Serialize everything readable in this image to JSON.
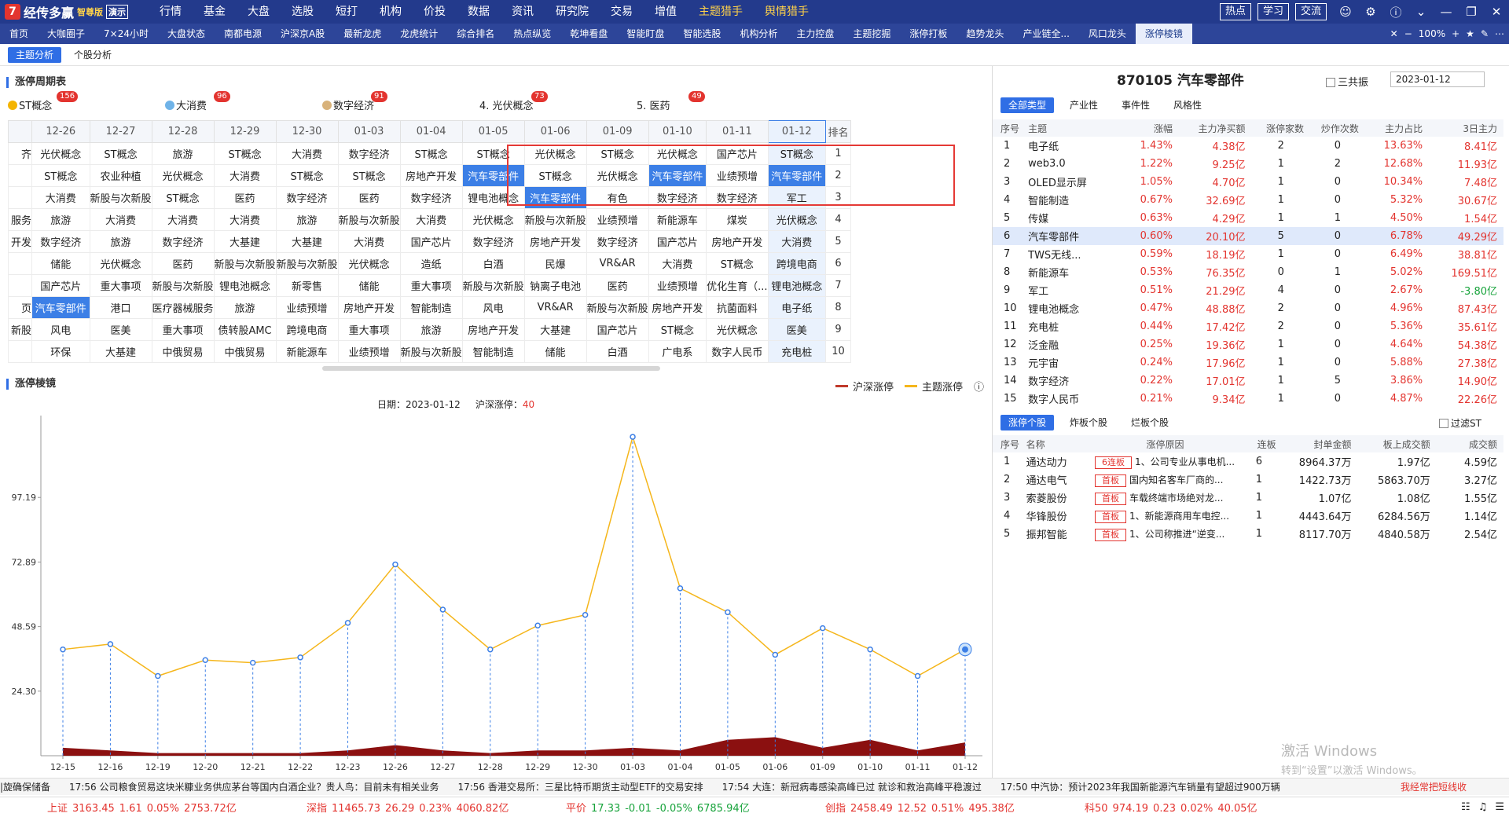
{
  "app": {
    "logo_mark": "7",
    "brand": "经传多赢",
    "edition": "智尊版",
    "demo": "演示"
  },
  "mainmenu": [
    "行情",
    "基金",
    "大盘",
    "选股",
    "短打",
    "机构",
    "价投",
    "数据",
    "资讯",
    "研究院",
    "交易",
    "增值",
    "主题猎手",
    "舆情猎手"
  ],
  "topright": {
    "hot": "热点",
    "study": "学习",
    "talk": "交流"
  },
  "tabs": [
    "首页",
    "大咖圈子",
    "7×24小时",
    "大盘状态",
    "南都电源",
    "沪深京A股",
    "最新龙虎",
    "龙虎统计",
    "综合排名",
    "热点纵览",
    "乾坤看盘",
    "智能盯盘",
    "智能选股",
    "机构分析",
    "主力控盘",
    "主题挖掘",
    "涨停打板",
    "趋势龙头",
    "产业链全...",
    "风口龙头",
    "涨停棱镜"
  ],
  "tabright": {
    "zoom": "100%"
  },
  "subtabs": [
    "主题分析",
    "个股分析"
  ],
  "cycle": {
    "title": "涨停周期表",
    "cats": [
      {
        "label": "ST概念",
        "badge": "156",
        "color": "#f4b400"
      },
      {
        "label": "大消费",
        "badge": "96",
        "color": "#6fb3e8"
      },
      {
        "label": "数字经济",
        "badge": "91",
        "color": "#d8b27a"
      },
      {
        "label": "4. 光伏概念",
        "badge": "73",
        "color": ""
      },
      {
        "label": "5. 医药",
        "badge": "49",
        "color": ""
      }
    ],
    "dates": [
      "12-26",
      "12-27",
      "12-28",
      "12-29",
      "12-30",
      "01-03",
      "01-04",
      "01-05",
      "01-06",
      "01-09",
      "01-10",
      "01-11",
      "01-12"
    ],
    "rank_header": "排名",
    "leftcol": [
      "齐",
      "",
      "",
      "服务",
      "开发",
      "",
      "",
      "页",
      "新股",
      "",
      ""
    ],
    "rows": [
      [
        "光伏概念",
        "ST概念",
        "旅游",
        "ST概念",
        "大消费",
        "数字经济",
        "ST概念",
        "ST概念",
        "光伏概念",
        "ST概念",
        "光伏概念",
        "国产芯片",
        "ST概念"
      ],
      [
        "ST概念",
        "农业种植",
        "光伏概念",
        "大消费",
        "ST概念",
        "ST概念",
        "房地产开发",
        "汽车零部件",
        "ST概念",
        "光伏概念",
        "汽车零部件",
        "业绩预增",
        "汽车零部件"
      ],
      [
        "大消费",
        "新股与次新股",
        "ST概念",
        "医药",
        "数字经济",
        "医药",
        "数字经济",
        "锂电池概念",
        "汽车零部件",
        "有色",
        "数字经济",
        "数字经济",
        "军工"
      ],
      [
        "旅游",
        "大消费",
        "大消费",
        "大消费",
        "旅游",
        "新股与次新股",
        "大消费",
        "光伏概念",
        "新股与次新股",
        "业绩预增",
        "新能源车",
        "煤炭",
        "光伏概念"
      ],
      [
        "数字经济",
        "旅游",
        "数字经济",
        "大基建",
        "大基建",
        "大消费",
        "国产芯片",
        "数字经济",
        "房地产开发",
        "数字经济",
        "国产芯片",
        "房地产开发",
        "大消费"
      ],
      [
        "储能",
        "光伏概念",
        "医药",
        "新股与次新股",
        "新股与次新股",
        "光伏概念",
        "造纸",
        "白酒",
        "民爆",
        "VR&AR",
        "大消费",
        "ST概念",
        "跨境电商"
      ],
      [
        "国产芯片",
        "重大事项",
        "新股与次新股",
        "锂电池概念",
        "新零售",
        "储能",
        "重大事项",
        "新股与次新股",
        "钠离子电池",
        "医药",
        "业绩预增",
        "优化生育（...",
        "锂电池概念"
      ],
      [
        "汽车零部件",
        "港口",
        "医疗器械服务",
        "旅游",
        "业绩预增",
        "房地产开发",
        "智能制造",
        "风电",
        "VR&AR",
        "新股与次新股",
        "房地产开发",
        "抗菌面料",
        "电子纸"
      ],
      [
        "风电",
        "医美",
        "重大事项",
        "债转股AMC",
        "跨境电商",
        "重大事项",
        "旅游",
        "房地产开发",
        "大基建",
        "国产芯片",
        "ST概念",
        "光伏概念",
        "医美"
      ],
      [
        "环保",
        "大基建",
        "中俄贸易",
        "中俄贸易",
        "新能源车",
        "业绩预增",
        "新股与次新股",
        "智能制造",
        "储能",
        "白酒",
        "广电系",
        "数字人民币",
        "充电桩"
      ]
    ],
    "ranks": [
      "1",
      "2",
      "3",
      "4",
      "5",
      "6",
      "7",
      "8",
      "9",
      "10"
    ]
  },
  "prism": {
    "title": "涨停棱镜",
    "legend": {
      "a": "沪深涨停",
      "b": "主题涨停",
      "a_color": "#c0392b",
      "b_color": "#f5b61b"
    },
    "date_label": "日期：",
    "date": "2023-01-12",
    "count_label": "沪深涨停：",
    "count": "40"
  },
  "chart_data": {
    "type": "line",
    "x": [
      "12-15",
      "12-16",
      "12-19",
      "12-20",
      "12-21",
      "12-22",
      "12-23",
      "12-26",
      "12-27",
      "12-28",
      "12-29",
      "12-30",
      "01-03",
      "01-04",
      "01-05",
      "01-06",
      "01-09",
      "01-10",
      "01-11",
      "01-12"
    ],
    "series": [
      {
        "name": "沪深涨停",
        "type": "line",
        "values": [
          40,
          42,
          30,
          36,
          35,
          37,
          50,
          72,
          55,
          40,
          49,
          53,
          120,
          63,
          54,
          38,
          48,
          40,
          30,
          40
        ],
        "color": "#f5b61b"
      },
      {
        "name": "主题涨停",
        "type": "area",
        "values": [
          3,
          2,
          1,
          1,
          1,
          1,
          2,
          4,
          2,
          1,
          2,
          2,
          3,
          2,
          6,
          7,
          3,
          6,
          2,
          5
        ],
        "color": "#8b1010"
      }
    ],
    "y_ticks": [
      "24.30",
      "48.59",
      "72.89",
      "97.19"
    ],
    "ylim": [
      0,
      128
    ]
  },
  "stock": {
    "title": "870105 汽车零部件",
    "sanban": "三共振",
    "date": "2023-01-12",
    "tabs": [
      "全部类型",
      "产业性",
      "事件性",
      "风格性"
    ],
    "headers": [
      "序号",
      "主题",
      "涨幅",
      "主力净买额",
      "涨停家数",
      "炒作次数",
      "主力占比",
      "3日主力"
    ],
    "rows": [
      [
        "1",
        "电子纸",
        "1.43%",
        "4.38亿",
        "2",
        "0",
        "13.63%",
        "8.41亿"
      ],
      [
        "2",
        "web3.0",
        "1.22%",
        "9.25亿",
        "1",
        "2",
        "12.68%",
        "11.93亿"
      ],
      [
        "3",
        "OLED显示屏",
        "1.05%",
        "4.70亿",
        "1",
        "0",
        "10.34%",
        "7.48亿"
      ],
      [
        "4",
        "智能制造",
        "0.67%",
        "32.69亿",
        "1",
        "0",
        "5.32%",
        "30.67亿"
      ],
      [
        "5",
        "传媒",
        "0.63%",
        "4.29亿",
        "1",
        "1",
        "4.50%",
        "1.54亿"
      ],
      [
        "6",
        "汽车零部件",
        "0.60%",
        "20.10亿",
        "5",
        "0",
        "6.78%",
        "49.29亿"
      ],
      [
        "7",
        "TWS无线...",
        "0.59%",
        "18.19亿",
        "1",
        "0",
        "6.49%",
        "38.81亿"
      ],
      [
        "8",
        "新能源车",
        "0.53%",
        "76.35亿",
        "0",
        "1",
        "5.02%",
        "169.51亿"
      ],
      [
        "9",
        "军工",
        "0.51%",
        "21.29亿",
        "4",
        "0",
        "2.67%",
        "-3.80亿"
      ],
      [
        "10",
        "锂电池概念",
        "0.47%",
        "48.88亿",
        "2",
        "0",
        "4.96%",
        "87.43亿"
      ],
      [
        "11",
        "充电桩",
        "0.44%",
        "17.42亿",
        "2",
        "0",
        "5.36%",
        "35.61亿"
      ],
      [
        "12",
        "泛金融",
        "0.25%",
        "19.36亿",
        "1",
        "0",
        "4.64%",
        "54.38亿"
      ],
      [
        "13",
        "元宇宙",
        "0.24%",
        "17.96亿",
        "1",
        "0",
        "5.88%",
        "27.38亿"
      ],
      [
        "14",
        "数字经济",
        "0.22%",
        "17.01亿",
        "1",
        "5",
        "3.86%",
        "14.90亿"
      ],
      [
        "15",
        "数字人民币",
        "0.21%",
        "9.34亿",
        "1",
        "0",
        "4.87%",
        "22.26亿"
      ]
    ],
    "selected": "6",
    "ztabs": [
      "涨停个股",
      "炸板个股",
      "烂板个股"
    ],
    "filter": "过滤ST",
    "zheaders": [
      "序号",
      "名称",
      "涨停原因",
      "连板",
      "封单金额",
      "板上成交额",
      "成交额"
    ],
    "zrows": [
      [
        "1",
        "通达动力",
        "6连板",
        "1、公司专业从事电机...",
        "6",
        "8964.37万",
        "1.97亿",
        "4.59亿"
      ],
      [
        "2",
        "通达电气",
        "首板",
        "国内知名客车厂商的...",
        "1",
        "1422.73万",
        "5863.70万",
        "3.27亿"
      ],
      [
        "3",
        "索菱股份",
        "首板",
        "车载终端市场绝对龙...",
        "1",
        "1.07亿",
        "1.08亿",
        "1.55亿"
      ],
      [
        "4",
        "华锋股份",
        "首板",
        "1、新能源商用车电控...",
        "1",
        "4443.64万",
        "6284.56万",
        "1.14亿"
      ],
      [
        "5",
        "振邦智能",
        "首板",
        "1、公司称推进“逆变...",
        "1",
        "8117.70万",
        "4840.58万",
        "2.54亿"
      ]
    ]
  },
  "watermark": {
    "a": "激活 Windows",
    "b": "转到“设置”以激活 Windows。"
  },
  "ticker": {
    "items": [
      "|旋确保储备",
      "17:56 公司粮食贸易这块米糠业务供应茅台等国内白酒企业？贵人鸟：目前未有相关业务",
      "17:56 香港交易所：三星比特币期货主动型ETF的交易安排",
      "17:54 大连：新冠病毒感染高峰已过 就诊和救治高峰平稳渡过",
      "17:50 中汽协：预计2023年我国新能源汽车销量有望超过900万辆"
    ],
    "link": "我经常把短线收"
  },
  "indices": [
    {
      "name": "上证",
      "value": "3163.45",
      "chg": "1.61",
      "pct": "0.05%",
      "amt": "2753.72亿",
      "dir": "up"
    },
    {
      "name": "深指",
      "value": "11465.73",
      "chg": "26.29",
      "pct": "0.23%",
      "amt": "4060.82亿",
      "dir": "up"
    },
    {
      "name": "平价",
      "value": "17.33",
      "chg": "-0.01",
      "pct": "-0.05%",
      "amt": "6785.94亿",
      "dir": "down"
    },
    {
      "name": "创指",
      "value": "2458.49",
      "chg": "12.52",
      "pct": "0.51%",
      "amt": "495.38亿",
      "dir": "up"
    },
    {
      "name": "科50",
      "value": "974.19",
      "chg": "0.23",
      "pct": "0.02%",
      "amt": "40.05亿",
      "dir": "up"
    }
  ]
}
